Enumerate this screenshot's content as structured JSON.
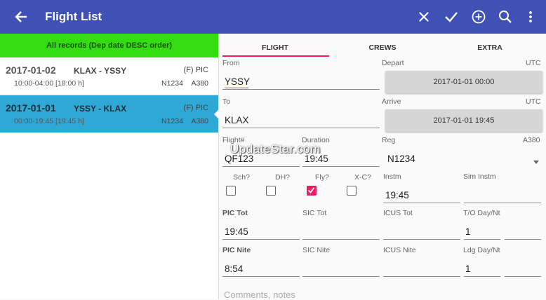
{
  "colors": {
    "appbar": "#3f51b5",
    "banner": "#33dd11",
    "selected_row": "#2fa8d6",
    "accent": "#e91e63"
  },
  "header": {
    "title": "Flight List",
    "icons": [
      "arrow-back-icon",
      "close-icon",
      "check-icon",
      "add-circle-icon",
      "search-icon",
      "more-vert-icon"
    ]
  },
  "list": {
    "banner": "All records (Dep date DESC order)",
    "records": [
      {
        "date": "2017-01-02",
        "route": "KLAX - YSSY",
        "role": "(F) PIC",
        "times": "10:00-04:00 [18:00 h]",
        "reg": "N1234",
        "aircraft": "A380"
      },
      {
        "date": "2017-01-01",
        "route": "YSSY - KLAX",
        "role": "(F) PIC",
        "times": "00:00-19:45 [19:45 h]",
        "reg": "N1234",
        "aircraft": "A380"
      }
    ]
  },
  "tabs": [
    "FLIGHT",
    "CREWS",
    "EXTRA"
  ],
  "form": {
    "from_label": "From",
    "from_value": "YSSY",
    "depart_label": "Depart",
    "depart_tz": "UTC",
    "depart_value": "2017-01-01  00:00",
    "to_label": "To",
    "to_value": "KLAX",
    "arrive_label": "Arrive",
    "arrive_tz": "UTC",
    "arrive_value": "2017-01-01  19:45",
    "flightno_label": "Flight#",
    "flightno_value": "QF123",
    "duration_label": "Duration",
    "duration_value": "19:45",
    "reg_label": "Reg",
    "reg_type": "A380",
    "reg_value": "N1234",
    "sch_label": "Sch?",
    "dh_label": "DH?",
    "fly_label": "Fly?",
    "xc_label": "X-C?",
    "instm_label": "Instm",
    "instm_value": "19:45",
    "siminstm_label": "Sim Instm",
    "pictot_label": "PIC Tot",
    "pictot_value": "19:45",
    "sictot_label": "SIC Tot",
    "icustot_label": "ICUS Tot",
    "to_daynt_label": "T/O Day/Nt",
    "to_day_value": "1",
    "picnite_label": "PIC Nite",
    "picnite_value": "8:54",
    "sicnite_label": "SIC Nite",
    "icusnite_label": "ICUS Nite",
    "ldg_daynt_label": "Ldg Day/Nt",
    "ldg_day_value": "1",
    "comments_placeholder": "Comments, notes"
  },
  "checkboxes": {
    "sch": false,
    "dh": false,
    "fly": true,
    "xc": false
  },
  "watermark": "UpdateStar.com"
}
